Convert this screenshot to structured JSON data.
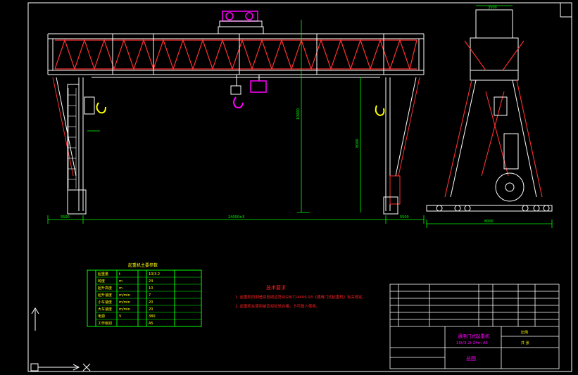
{
  "colors": {
    "background": "#000000",
    "structure": "#ffffff",
    "truss": "#ff3030",
    "dimension": "#00ff00",
    "hook": "#ffff00",
    "text": "#ffff00",
    "notes": "#ff2020",
    "table": "#00ff00",
    "accent": "#ff00ff"
  },
  "notes": {
    "title": "技术要求",
    "items": [
      "1. 起重机的制造及验收应符合GB/T14406-93《通用门式起重机》有关规定。",
      "2. 起重机在使用前应经检验合格，方可投入使用。"
    ]
  },
  "param_table": {
    "title": "起重机主要参数",
    "rows": [
      {
        "name": "起重量",
        "unit": "t",
        "value": "10/3.2"
      },
      {
        "name": "跨度",
        "unit": "m",
        "value": "24"
      },
      {
        "name": "起升高度",
        "unit": "m",
        "value": "10"
      },
      {
        "name": "起升速度",
        "unit": "m/min",
        "value": "7"
      },
      {
        "name": "小车速度",
        "unit": "m/min",
        "value": "20"
      },
      {
        "name": "大车速度",
        "unit": "m/min",
        "value": "20"
      },
      {
        "name": "电源",
        "unit": "V",
        "value": "380"
      },
      {
        "name": "工作级别",
        "unit": "",
        "value": "A5"
      }
    ]
  },
  "title_block": {
    "drawing_name": "通用门式起重机",
    "spec": "10t/3.2t 24m A5",
    "view_name": "总图",
    "scale_label": "比例",
    "sheet_label": "共 张"
  },
  "dimensions": {
    "span": "24000±3",
    "left_overhang": "5500",
    "right_overhang": "5500",
    "lift_height": "10000",
    "inner_height": "8000",
    "side_base": "8000",
    "side_top": "3500"
  }
}
